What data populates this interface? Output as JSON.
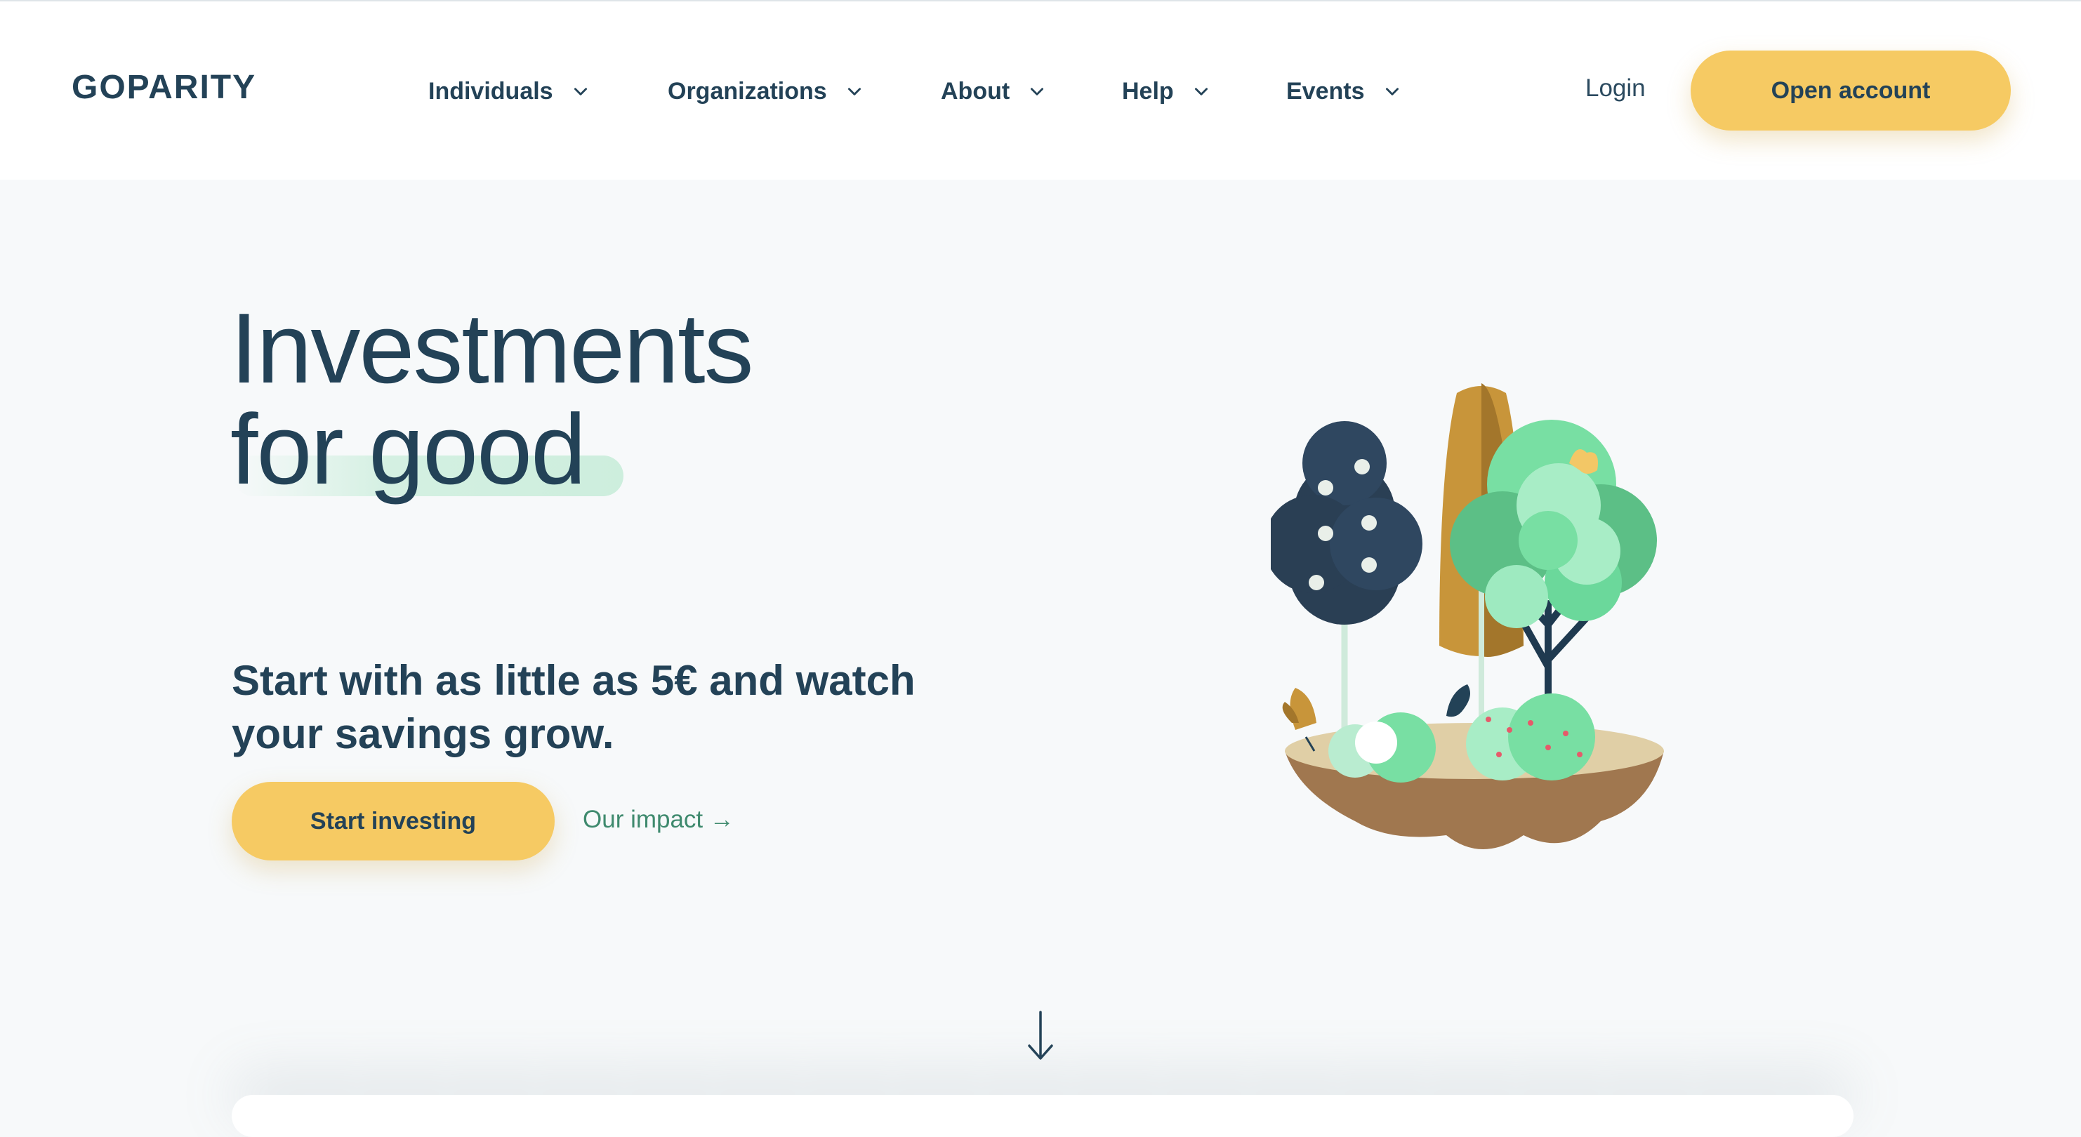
{
  "brand": {
    "name": "GOPARITY",
    "primary_color": "#234257",
    "accent_color": "#f6ca63",
    "link_color": "#3f8a6e"
  },
  "nav": {
    "items": [
      {
        "label": "Individuals",
        "icon": "chevron-down-icon"
      },
      {
        "label": "Organizations",
        "icon": "chevron-down-icon"
      },
      {
        "label": "About",
        "icon": "chevron-down-icon"
      },
      {
        "label": "Help",
        "icon": "chevron-down-icon"
      },
      {
        "label": "Events",
        "icon": "chevron-down-icon"
      }
    ],
    "login_label": "Login",
    "cta_label": "Open account"
  },
  "hero": {
    "title_line1": "Investments",
    "title_line2": "for good",
    "subtitle_line1": "Start with as little as 5€ and watch",
    "subtitle_line2": "your savings grow.",
    "primary_cta": "Start investing",
    "secondary_link": "Our impact →",
    "illustration": "floating-island-trees-icon",
    "scroll_icon": "arrow-down-icon"
  }
}
